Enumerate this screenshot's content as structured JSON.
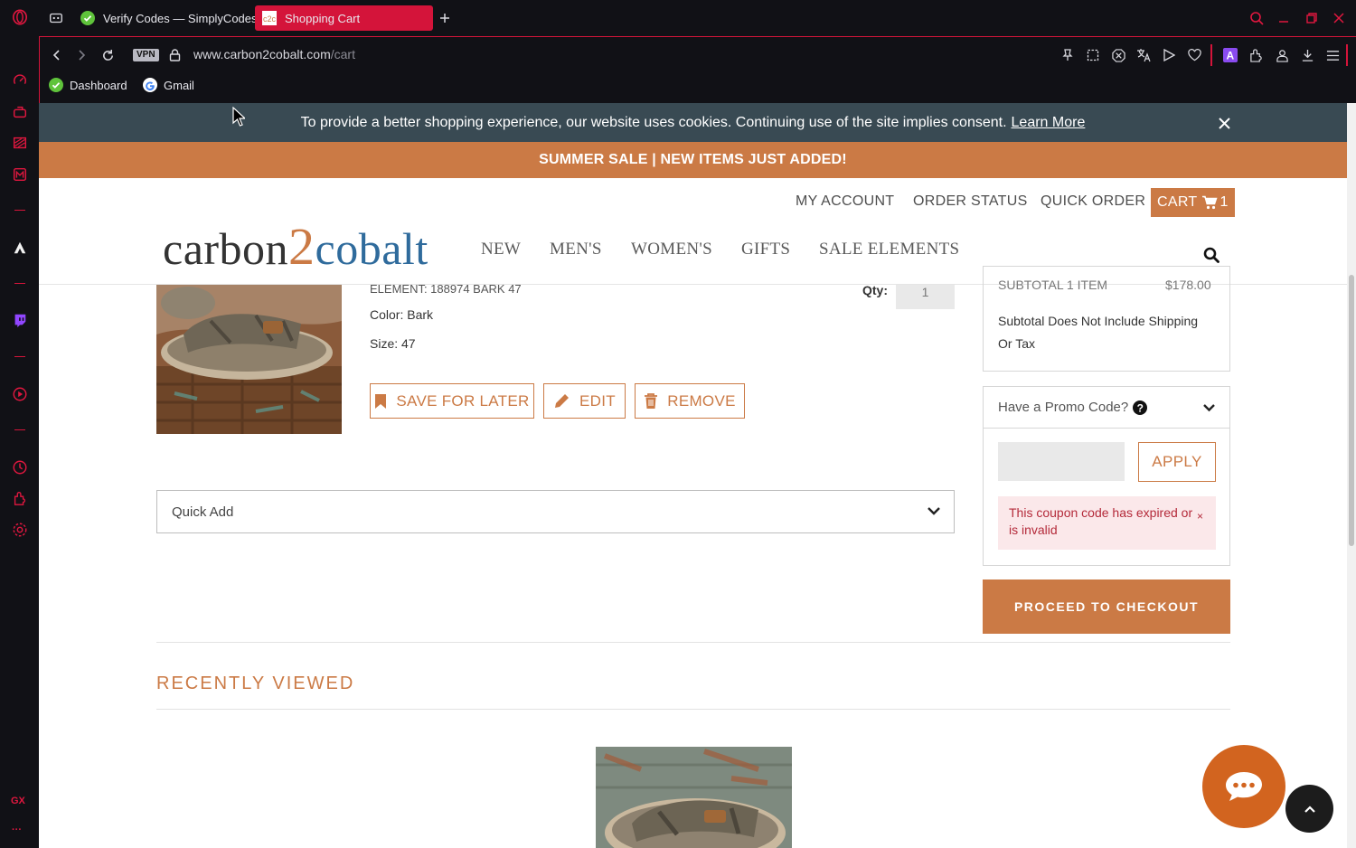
{
  "browser": {
    "tabs": [
      {
        "label": "Verify Codes — SimplyCodes",
        "active": false
      },
      {
        "label": "Shopping Cart",
        "active": true
      }
    ],
    "url_host": "www.carbon2cobalt.com",
    "url_path": "/cart",
    "vpn_label": "VPN",
    "bookmarks": [
      {
        "label": "Dashboard"
      },
      {
        "label": "Gmail"
      }
    ],
    "sidebar_gx": "GX",
    "sidebar_more": "···"
  },
  "cookie_banner": {
    "text": "To provide a better shopping experience, our website uses cookies. Continuing use of the site implies consent.",
    "link": "Learn More"
  },
  "sale_banner": "SUMMER SALE | NEW ITEMS JUST ADDED!",
  "header": {
    "my_account": "MY ACCOUNT",
    "order_status": "ORDER STATUS",
    "quick_order": "QUICK ORDER",
    "cart_label": "CART",
    "cart_count": "1",
    "logo_a": "carbon",
    "logo_b": "2",
    "logo_c": "cobalt",
    "nav": [
      "NEW",
      "MEN'S",
      "WOMEN'S",
      "GIFTS",
      "SALE ELEMENTS"
    ]
  },
  "cart_item": {
    "sku": "ELEMENT: 188974 BARK 47",
    "color": "Color: Bark",
    "size": "Size: 47",
    "qty_label": "Qty:",
    "qty_value": "1",
    "save_label": "SAVE FOR LATER",
    "edit_label": "EDIT",
    "remove_label": "REMOVE"
  },
  "quick_add": "Quick Add",
  "summary": {
    "subtotal_label": "SUBTOTAL 1 ITEM",
    "subtotal_value": "$178.00",
    "note": "Subtotal Does Not Include Shipping Or Tax",
    "promo_label": "Have a Promo Code?",
    "apply_label": "APPLY",
    "error": "This coupon code has expired or is invalid",
    "error_close": "×",
    "checkout_label": "PROCEED TO CHECKOUT"
  },
  "recently_viewed": "RECENTLY VIEWED",
  "colors": {
    "accent": "#cb7a45",
    "browser_red": "#d4143a",
    "cookie_bg": "#394a53",
    "error_text": "#b42a3a"
  }
}
